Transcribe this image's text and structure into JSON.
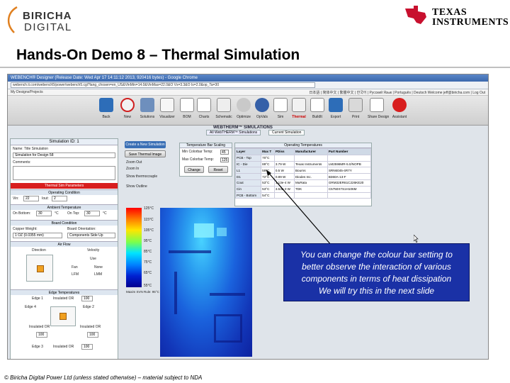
{
  "slide": {
    "title": "Hands-On Demo 8 – Thermal Simulation",
    "footer": "© Biricha Digital Power Ltd  (unless stated otherwise) – material subject to NDA",
    "logo_left": {
      "line1": "BIRICHA",
      "line2": "DIGITAL"
    },
    "logo_right": {
      "line1": "TEXAS",
      "line2": "INSTRUMENTS"
    }
  },
  "browser": {
    "window_title": "WEBENCH® Designer (Release Date: Wed Apr 17 14:11:12 2013, 920416 bytes) - Google Chrome",
    "url": "webench.ti.com/webench5/power/webench5.cgi?lang_chosen=en_US&VinMin=14.0&VinMax=22.0&O Vs=3.3&O Is=2.0&op_Ta=30",
    "left_link": "My Designs/Projects",
    "right_links": "日本語 | 简体中文 | 繁體中文 | 한국어 | Pусский Язык | Português | Deutsch     Welcome jeff@biricha.com | Log Out"
  },
  "toolbar": {
    "items": [
      "Back",
      "New",
      "Solutions",
      "Visualizer",
      "BOM",
      "Charts",
      "Schematic",
      "Optimize",
      "OpVals",
      "Sim",
      "Thermal",
      "BuildIt",
      "Export",
      "Print",
      "Share Design",
      "Assistant"
    ]
  },
  "tabs": {
    "banner": "WEBTHERM™ SIMULATIONS",
    "items": [
      "All WebTHERM™ Simulations",
      "Current Simulation"
    ]
  },
  "left_panel": {
    "header": "Simulation ID: 1",
    "name_label": "Name: Title Simulation",
    "name_value": "Simulation for Design 58",
    "comments_label": "Comments:",
    "thermal_params": "Thermal Sim Parameters",
    "operating_condition": "Operating Condition",
    "vin_label": "Vin:",
    "vin_value": "22",
    "iout_label": "Iout:",
    "iout_value": "2",
    "ambient": "Ambient Temperature",
    "on_bottom_label": "On Bottom:",
    "on_bottom_value": "30",
    "on_top_label": "On Top:",
    "on_top_value": "30",
    "unit_c": "°C",
    "board_condition": "Board Condition",
    "copper_weight_label": "Copper Weight:",
    "copper_weight_value": "1 OZ (0.0355 mm)",
    "board_orientation_label": "Board Orientation:",
    "board_orientation_value": "Components Side Up",
    "air_flow": "Air Flow",
    "direction_label": "Direction",
    "velocity_label": "Velocity",
    "use_label": "Use",
    "velocity_opts": [
      "Fan",
      "None",
      "LFM",
      "LMM"
    ],
    "edge_temps": "Edge Temperatures",
    "edge1_label": "Edge 1",
    "edge2_label": "Edge 2",
    "edge3_label": "Edge 3",
    "edge4_label": "Edge 4",
    "insulated_label": "Insulated OR",
    "edge_value": "100"
  },
  "controls": {
    "create_btn": "Create a New Simulation",
    "save_btn": "Save Thermal Image",
    "zoom_out": "Zoom Out",
    "zoom_in": "Zoom In",
    "show_thermocouple": "Show thermocouple",
    "show_outline": "Show Outline",
    "scale_header": "Temperature Bar Scaling",
    "min_label": "Min Colorbar Temp:",
    "min_value": "45",
    "max_label": "Max Colorbar Temp:",
    "max_value": "125",
    "change_btn": "Change",
    "reset_btn": "Reset"
  },
  "operating_temps": {
    "header": "Operating Temperatures",
    "columns": [
      "Layer",
      "Max T",
      "PDiss",
      "Manufacturer",
      "Part Number"
    ],
    "rows": [
      [
        "PCB - Top",
        "70°C",
        "",
        "",
        ""
      ],
      [
        "IC - Die",
        "89°C",
        "3.79 W",
        "Texas Instruments",
        "LM2596MR-5.0/NOPB"
      ],
      [
        "L1",
        "59°C",
        "0.5 W",
        "Bourns",
        "SRN6045-4R7Y"
      ],
      [
        "D1",
        "72°C",
        "0.89 W",
        "Diodes Inc.",
        "B360A-13-F"
      ],
      [
        "Cout",
        "53°C",
        "1.13e-4 W",
        "MuRata",
        "GRM32ER61C226KE20"
      ],
      [
        "Cin",
        "53°C",
        "3.53e-3 W",
        "TDK",
        "C5750X7S1H106M"
      ],
      [
        "PCB - Bottom",
        "54°C",
        "",
        "",
        ""
      ]
    ]
  },
  "colorbar": {
    "labels": [
      "125°C",
      "115°C",
      "105°C",
      "95°C",
      "85°C",
      "75°C",
      "65°C",
      "55°C"
    ],
    "footnote": "Maxim SVN Rule: 95°C"
  },
  "callout": {
    "line1": "You can change the colour bar setting to",
    "line2": "better observe the interaction of various",
    "line3": "components in terms of heat dissipation",
    "line4": "We will try this in the next slide"
  },
  "colors": {
    "accent_red": "#d81e1e",
    "callout_blue": "#1a31a6",
    "toolbar_blue": "#3a6fb5"
  }
}
